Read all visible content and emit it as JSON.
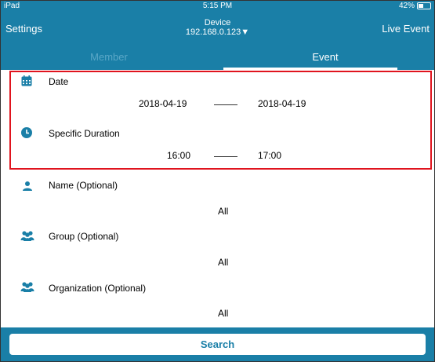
{
  "status_bar": {
    "device": "iPad",
    "time": "5:15 PM",
    "battery": "42%"
  },
  "nav": {
    "left": "Settings",
    "title": "Device",
    "subtitle": "192.168.0.123▼",
    "right": "Live Event"
  },
  "tabs": [
    {
      "label": "Member"
    },
    {
      "label": "Event"
    }
  ],
  "date": {
    "title": "Date",
    "start": "2018-04-19",
    "end": "2018-04-19"
  },
  "duration": {
    "title": "Specific Duration",
    "start": "16:00",
    "end": "17:00"
  },
  "name": {
    "title": "Name (Optional)",
    "value": "All"
  },
  "group": {
    "title": "Group (Optional)",
    "value": "All"
  },
  "organization": {
    "title": "Organization (Optional)",
    "value": "All"
  },
  "search_label": "Search",
  "colors": {
    "accent": "#1a7fa7",
    "highlight": "#e0141e"
  }
}
